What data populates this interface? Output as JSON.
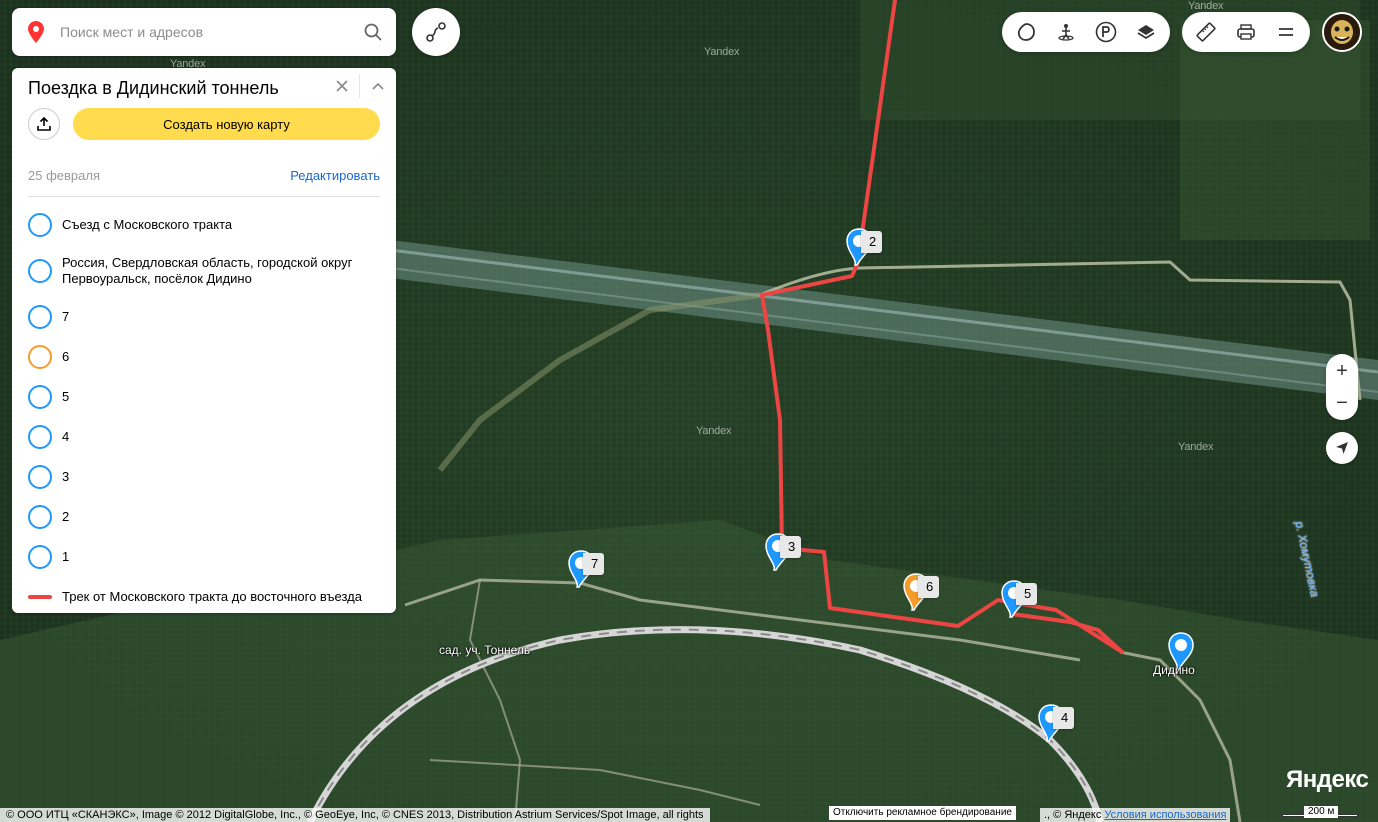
{
  "search": {
    "placeholder": "Поиск мест и адресов"
  },
  "panel": {
    "title": "Поездка в Дидинский тоннель",
    "create_label": "Создать новую карту",
    "date": "25 февраля",
    "edit_label": "Редактировать",
    "items": [
      {
        "label": "Съезд с Московского тракта",
        "kind": "point",
        "color": "#1e98ff"
      },
      {
        "label": "Россия, Свердловская область, городской округ Первоуральск, посёлок Дидино",
        "kind": "point",
        "color": "#1e98ff"
      },
      {
        "label": "7",
        "kind": "point",
        "color": "#1e98ff"
      },
      {
        "label": "6",
        "kind": "point",
        "color": "#f59b2c"
      },
      {
        "label": "5",
        "kind": "point",
        "color": "#1e98ff"
      },
      {
        "label": "4",
        "kind": "point",
        "color": "#1e98ff"
      },
      {
        "label": "3",
        "kind": "point",
        "color": "#1e98ff"
      },
      {
        "label": "2",
        "kind": "point",
        "color": "#1e98ff"
      },
      {
        "label": "1",
        "kind": "point",
        "color": "#1e98ff"
      },
      {
        "label": "Трек от Московского тракта до восточного въезда",
        "kind": "line",
        "color": "#ed4543"
      }
    ]
  },
  "map": {
    "watermark": "Yandex",
    "markers": {
      "m2": {
        "label": "2",
        "color": "#1e98ff"
      },
      "m3": {
        "label": "3",
        "color": "#1e98ff"
      },
      "m4": {
        "label": "4",
        "color": "#1e98ff"
      },
      "m5": {
        "label": "5",
        "color": "#1e98ff"
      },
      "m6": {
        "label": "6",
        "color": "#f59b2c"
      },
      "m7": {
        "label": "7",
        "color": "#1e98ff"
      },
      "didino": {
        "color": "#1e98ff"
      }
    },
    "place_label_tunnel": "сад. уч. Тоннель",
    "place_label_didino": "Дидино",
    "river_label": "р. Хомутовка",
    "track_color": "#ed4543"
  },
  "controls": {
    "zoom_in": "+",
    "zoom_out": "−"
  },
  "footer": {
    "logo": "Яндекс",
    "scale": "200 м",
    "copyright": "© ООО ИТЦ «СКАНЭКС», Image © 2012 DigitalGlobe, Inc., © GeoEye, Inc, © CNES 2013, Distribution Astrium Services/Spot Image, all rights",
    "adv": "Отключить рекламное брендирование",
    "copyright2": "., © Яндекс",
    "terms": "Условия использования"
  }
}
